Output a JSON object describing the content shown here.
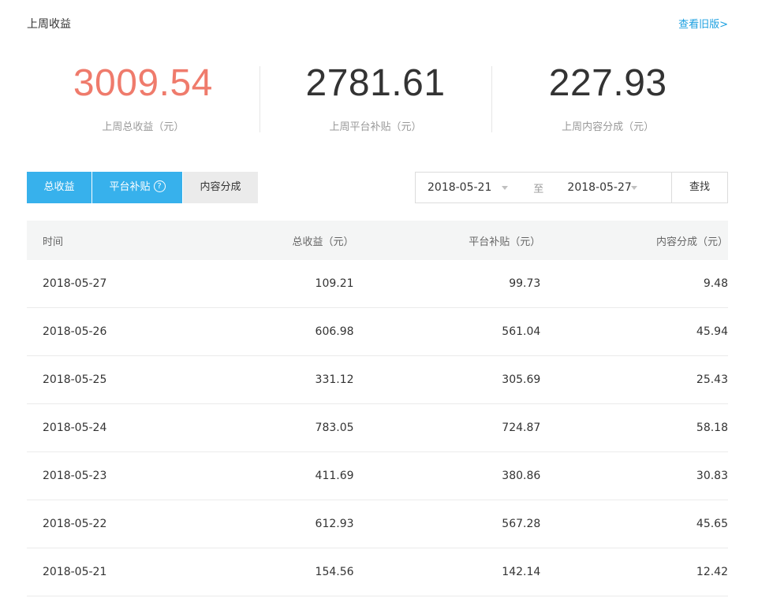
{
  "header": {
    "title": "上周收益",
    "old_version_link": "查看旧版>"
  },
  "stats": [
    {
      "value": "3009.54",
      "label": "上周总收益（元）"
    },
    {
      "value": "2781.61",
      "label": "上周平台补贴（元）"
    },
    {
      "value": "227.93",
      "label": "上周内容分成（元）"
    }
  ],
  "colors": {
    "accent_value": "#ef7b6c",
    "tab_active": "#37b1ec",
    "link": "#1a9fe0"
  },
  "tabs": [
    {
      "label": "总收益"
    },
    {
      "label": "平台补贴"
    },
    {
      "label": "内容分成"
    }
  ],
  "help_icon_glyph": "?",
  "date_range": {
    "start": "2018-05-21",
    "separator": "至",
    "end": "2018-05-27",
    "search_label": "查找"
  },
  "table": {
    "headers": [
      "时间",
      "总收益（元）",
      "平台补贴（元）",
      "内容分成（元）"
    ],
    "rows": [
      [
        "2018-05-27",
        "109.21",
        "99.73",
        "9.48"
      ],
      [
        "2018-05-26",
        "606.98",
        "561.04",
        "45.94"
      ],
      [
        "2018-05-25",
        "331.12",
        "305.69",
        "25.43"
      ],
      [
        "2018-05-24",
        "783.05",
        "724.87",
        "58.18"
      ],
      [
        "2018-05-23",
        "411.69",
        "380.86",
        "30.83"
      ],
      [
        "2018-05-22",
        "612.93",
        "567.28",
        "45.65"
      ],
      [
        "2018-05-21",
        "154.56",
        "142.14",
        "12.42"
      ]
    ]
  }
}
